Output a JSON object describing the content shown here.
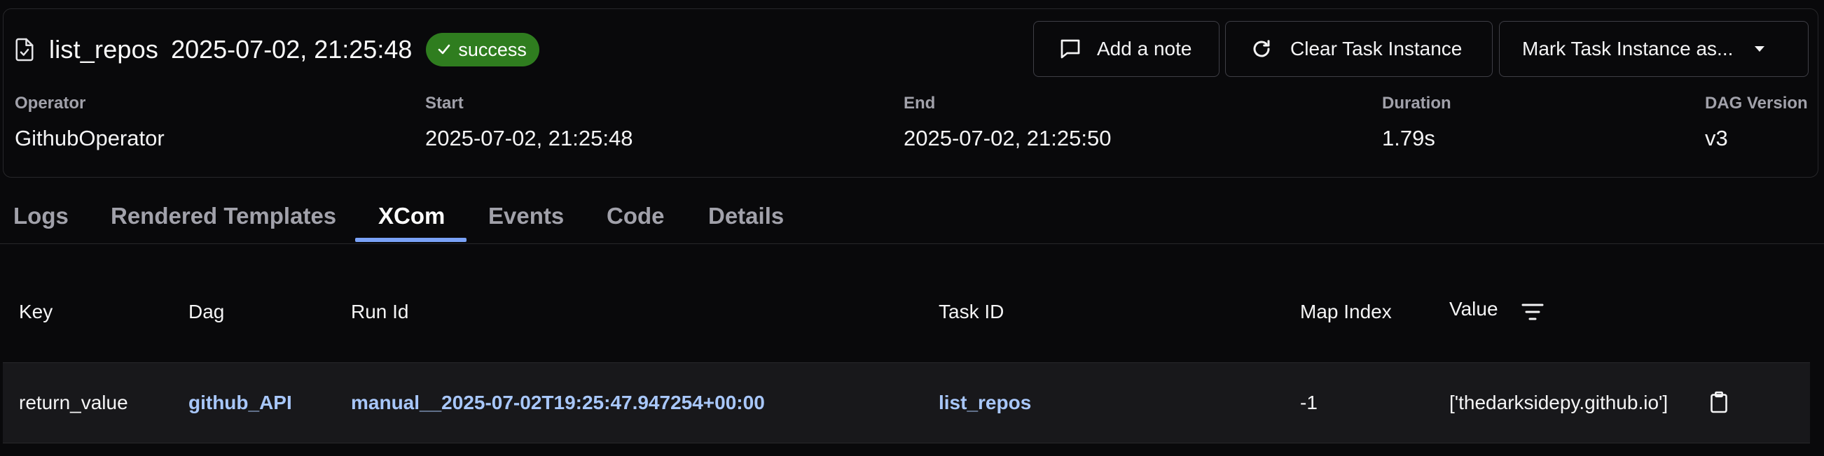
{
  "header": {
    "task_name": "list_repos",
    "date": "2025-07-02, 21:25:48",
    "status": "success",
    "add_note_label": "Add a note",
    "clear_label": "Clear Task Instance",
    "mark_label": "Mark Task Instance as..."
  },
  "meta": {
    "operator_label": "Operator",
    "operator_value": "GithubOperator",
    "start_label": "Start",
    "start_value": "2025-07-02, 21:25:48",
    "end_label": "End",
    "end_value": "2025-07-02, 21:25:50",
    "duration_label": "Duration",
    "duration_value": "1.79s",
    "dag_version_label": "DAG Version",
    "dag_version_value": "v3"
  },
  "tabs": [
    {
      "label": "Logs"
    },
    {
      "label": "Rendered Templates"
    },
    {
      "label": "XCom"
    },
    {
      "label": "Events"
    },
    {
      "label": "Code"
    },
    {
      "label": "Details"
    }
  ],
  "active_tab": "XCom",
  "table": {
    "columns": [
      "Key",
      "Dag",
      "Run Id",
      "Task ID",
      "Map Index",
      "Value"
    ],
    "rows": [
      {
        "key": "return_value",
        "dag": "github_API",
        "run_id": "manual__2025-07-02T19:25:47.947254+00:00",
        "task_id": "list_repos",
        "map_index": "-1",
        "value": "['thedarksidepy.github.io']"
      }
    ]
  },
  "colors": {
    "background": "#09090b",
    "success": "#2f7d1f",
    "link": "#a8c7fa",
    "tab_indicator": "#7aa2f7"
  },
  "icons": [
    "file-check-icon",
    "check-icon",
    "message-square-icon",
    "rotate-cw-icon",
    "chevron-down-icon",
    "filter-icon",
    "clipboard-icon"
  ]
}
